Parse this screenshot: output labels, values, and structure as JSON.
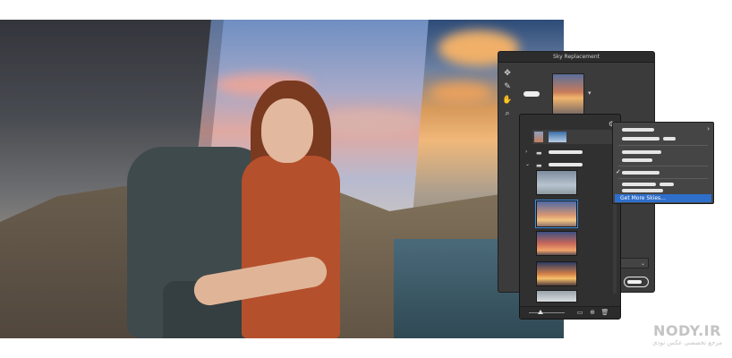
{
  "dialog": {
    "title": "Sky Replacement",
    "tools": [
      {
        "name": "move-tool-icon",
        "glyph": "✥"
      },
      {
        "name": "sky-brush-icon",
        "glyph": "✎"
      },
      {
        "name": "hand-tool-icon",
        "glyph": "✋"
      },
      {
        "name": "zoom-tool-icon",
        "glyph": "⌕"
      }
    ],
    "dropdown_chevron": "▾",
    "select_chevron": "⌄"
  },
  "preset_panel": {
    "gear_glyph": "⚙",
    "group_rows": [
      {
        "twisty": "›",
        "folder": "▬"
      },
      {
        "twisty": "⌄",
        "folder": "▬"
      }
    ],
    "footer_icons": [
      "▭",
      "⊕",
      "🗑"
    ]
  },
  "context_menu": {
    "check_glyph": "✓",
    "arrow_glyph": "›",
    "get_more_label": "Get More Skies..."
  },
  "watermark": {
    "main": "NODY.IR",
    "sub": "مرجع تخصصی عکس نودی"
  },
  "colors": {
    "dialog_bg": "#3b3b3b",
    "menu_highlight": "#2f6fcc"
  }
}
